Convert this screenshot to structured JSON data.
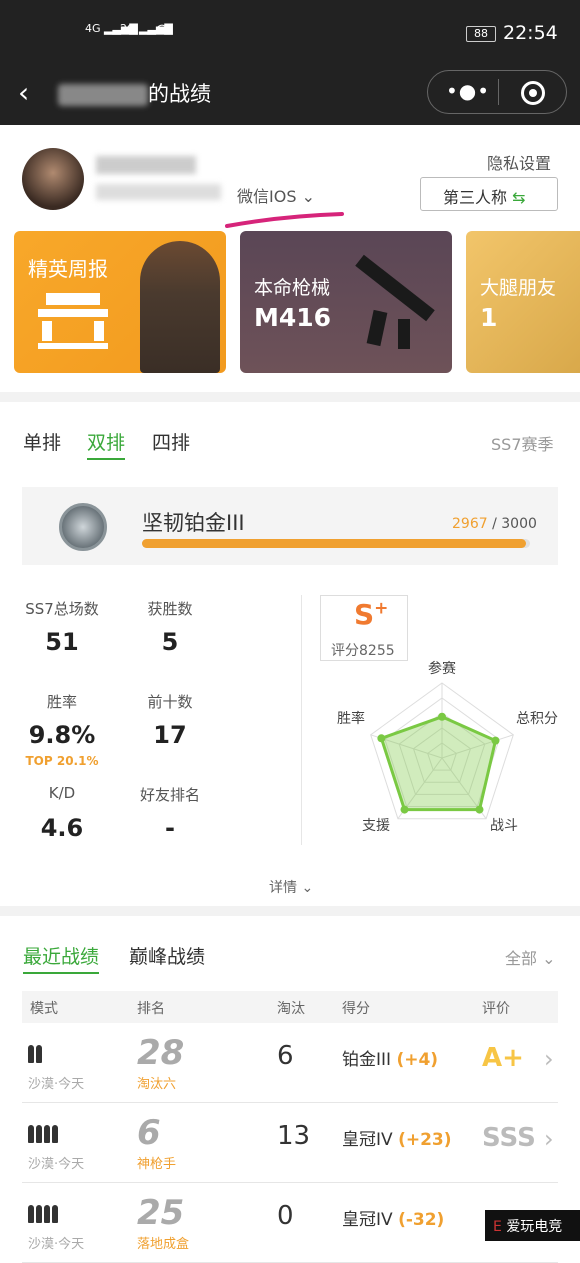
{
  "status_bar": {
    "signal1": "4G",
    "signal2": "2G",
    "battery": "88",
    "time": "22:54"
  },
  "nav": {
    "title": "的战绩",
    "more_icon": "more-dots-icon",
    "target_icon": "target-icon"
  },
  "profile": {
    "platform": "微信IOS",
    "privacy": "隐私设置",
    "view_mode": "第三人称"
  },
  "cards": [
    {
      "title": "精英周报",
      "value": ""
    },
    {
      "title": "本命枪械",
      "value": "M416"
    },
    {
      "title": "大腿朋友",
      "value": "1"
    }
  ],
  "modes": {
    "tabs": [
      "单排",
      "双排",
      "四排"
    ],
    "active": "双排",
    "season": "SS7赛季"
  },
  "rank": {
    "name": "坚韧铂金III",
    "current": 2967,
    "separator": "/",
    "max": 3000,
    "progress": 0.989
  },
  "stats": {
    "total_label": "SS7总场数",
    "total": "51",
    "wins_label": "获胜数",
    "wins": "5",
    "winrate_label": "胜率",
    "winrate": "9.8%",
    "top": "TOP 20.1%",
    "top10_label": "前十数",
    "top10": "17",
    "kd_label": "K/D",
    "kd": "4.6",
    "friend_rank_label": "好友排名",
    "friend_rank": "-"
  },
  "score": {
    "grade": "S",
    "grade_suffix": "+",
    "label": "评分8255"
  },
  "radar": {
    "labels": [
      "参赛",
      "总积分",
      "战斗",
      "支援",
      "胜率"
    ],
    "values": [
      0.55,
      0.75,
      0.85,
      0.85,
      0.85
    ],
    "color": "#7ac943"
  },
  "details_label": "详情",
  "recent": {
    "tabs": [
      "最近战绩",
      "巅峰战绩"
    ],
    "filter": "全部",
    "headers": [
      "模式",
      "排名",
      "淘汰",
      "得分",
      "评价"
    ],
    "rows": [
      {
        "mode": "沙漠·今天",
        "rank": "28",
        "rank_label": "淘汰六",
        "kills": "6",
        "tier": "铂金III",
        "delta": "(+4)",
        "grade": "A+",
        "players": 2
      },
      {
        "mode": "沙漠·今天",
        "rank": "6",
        "rank_label": "神枪手",
        "kills": "13",
        "tier": "皇冠IV",
        "delta": "(+23)",
        "grade": "SSS",
        "players": 4
      },
      {
        "mode": "沙漠·今天",
        "rank": "25",
        "rank_label": "落地成盒",
        "kills": "0",
        "tier": "皇冠IV",
        "delta": "(-32)",
        "grade": "",
        "players": 4
      }
    ]
  },
  "watermark": "爱玩电竞"
}
